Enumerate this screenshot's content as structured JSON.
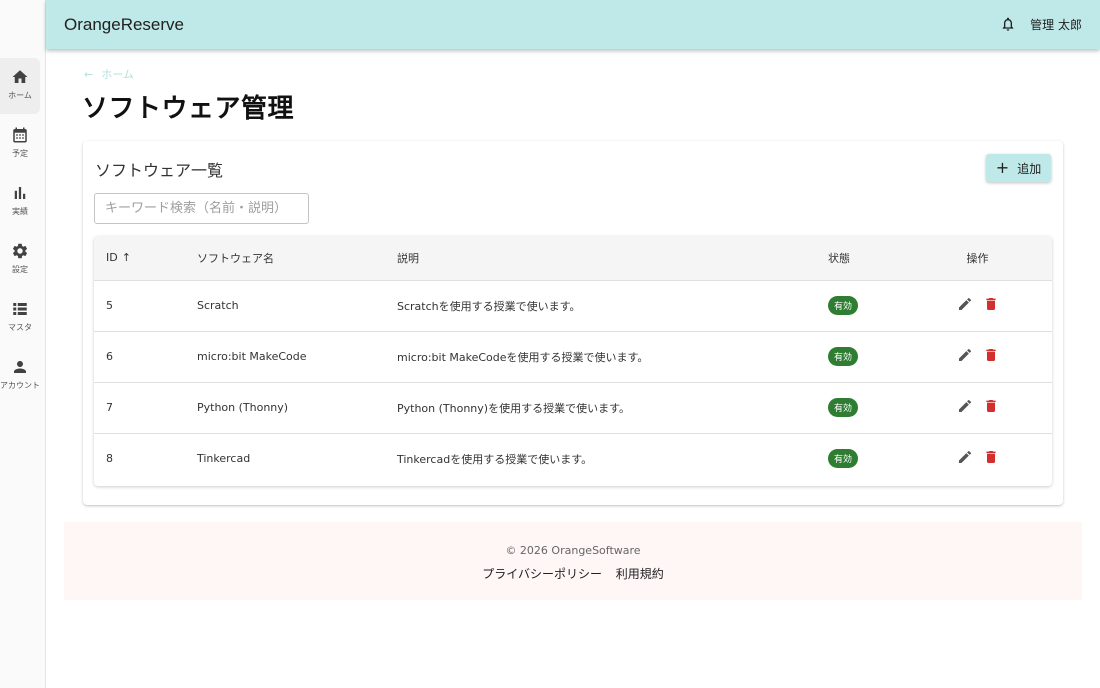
{
  "sidebar": {
    "items": [
      {
        "label": "ホーム",
        "icon": "home-icon"
      },
      {
        "label": "予定",
        "icon": "calendar-icon"
      },
      {
        "label": "実績",
        "icon": "bar-chart-icon"
      },
      {
        "label": "設定",
        "icon": "gear-icon"
      },
      {
        "label": "マスタ",
        "icon": "list-icon"
      },
      {
        "label": "アカウント",
        "icon": "person-icon"
      }
    ]
  },
  "appbar": {
    "title": "OrangeReserve",
    "user_name": "管理 太郎"
  },
  "breadcrumb": {
    "label": "ホーム"
  },
  "page": {
    "title": "ソフトウェア管理"
  },
  "card": {
    "title": "ソフトウェア一覧",
    "add_label": "追加",
    "search_placeholder": "キーワード検索（名前・説明）"
  },
  "table": {
    "headers": {
      "id": "ID",
      "name": "ソフトウェア名",
      "desc": "説明",
      "status": "状態",
      "actions": "操作"
    },
    "rows": [
      {
        "id": "5",
        "name": "Scratch",
        "desc": "Scratchを使用する授業で使います。",
        "status": "有効"
      },
      {
        "id": "6",
        "name": "micro:bit MakeCode",
        "desc": "micro:bit MakeCodeを使用する授業で使います。",
        "status": "有効"
      },
      {
        "id": "7",
        "name": "Python (Thonny)",
        "desc": "Python (Thonny)を使用する授業で使います。",
        "status": "有効"
      },
      {
        "id": "8",
        "name": "Tinkercad",
        "desc": "Tinkercadを使用する授業で使います。",
        "status": "有効"
      }
    ]
  },
  "footer": {
    "copyright": "© 2026 OrangeSoftware",
    "privacy": "プライバシーポリシー",
    "terms": "利用規約"
  },
  "colors": {
    "appbar": "#bfe8e8",
    "badge": "#2e7d32",
    "delete": "#d32f2f",
    "edit": "#555555",
    "footer_bg": "#fff6f6"
  }
}
